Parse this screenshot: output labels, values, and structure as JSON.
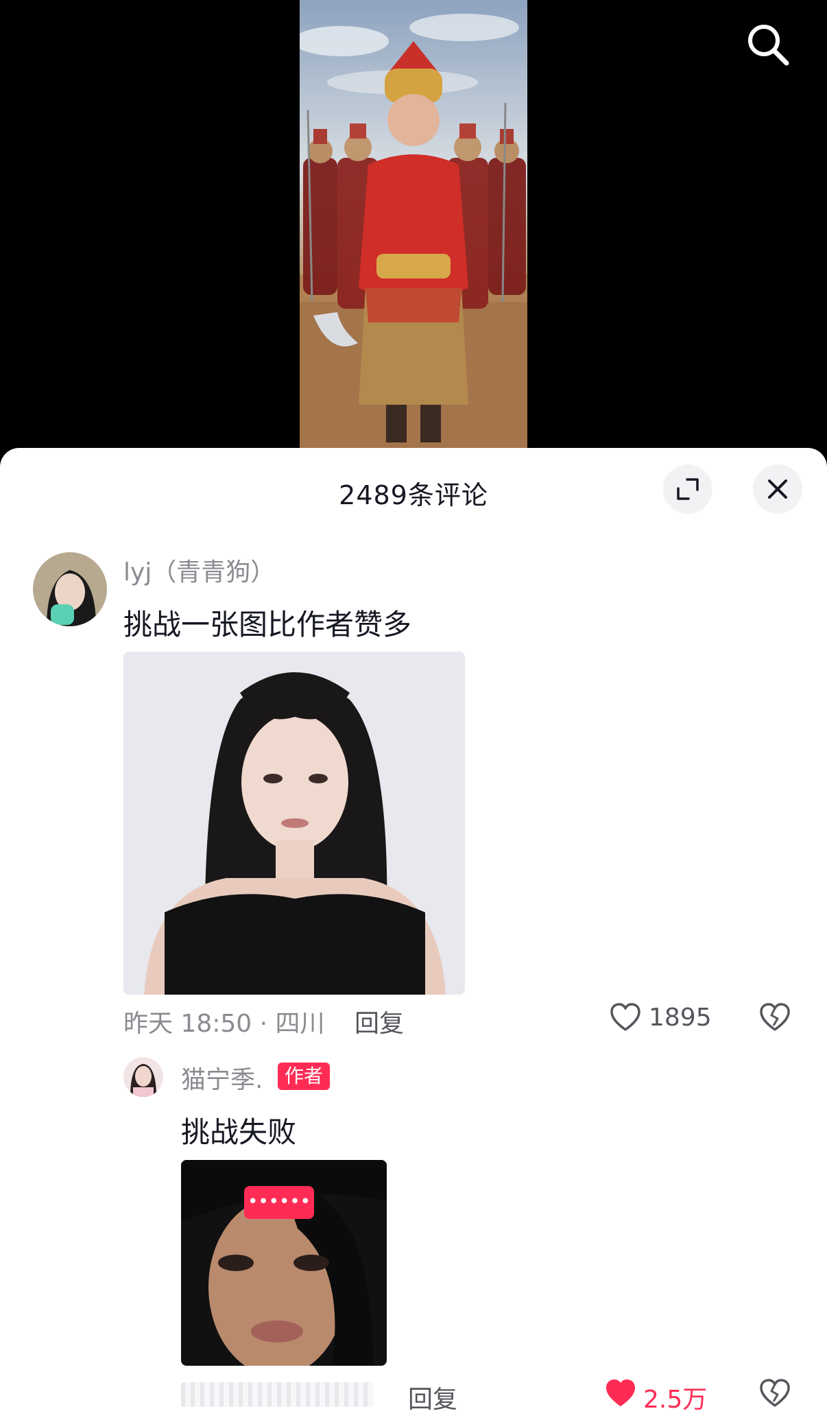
{
  "header": {
    "search_icon": "search-icon"
  },
  "sheet": {
    "title": "2489条评论",
    "expand_icon": "expand-icon",
    "close_icon": "close-icon"
  },
  "comments": [
    {
      "username": "lyj（青青狗）",
      "text": "挑战一张图比作者赞多",
      "time_location": "昨天 18:50 · 四川",
      "reply_label": "回复",
      "like_count": "1895",
      "liked": false,
      "replies": [
        {
          "username": "猫宁季.",
          "badge": "作者",
          "text": "挑战失败",
          "image_overlay": "••••••",
          "reply_label": "回复",
          "like_count": "2.5万",
          "liked": true
        }
      ]
    }
  ],
  "colors": {
    "accent": "#fe2c55",
    "text": "#161823",
    "muted": "#8a8b91"
  }
}
